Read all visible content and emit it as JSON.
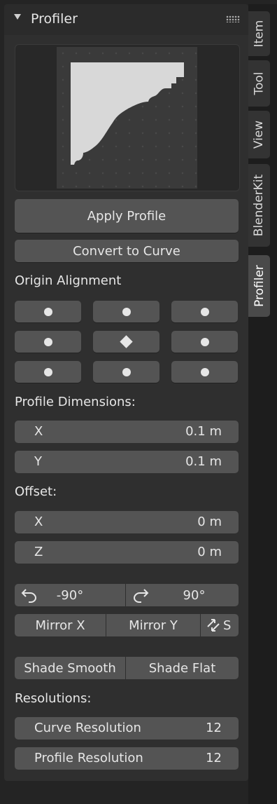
{
  "panel": {
    "title": "Profiler",
    "collapse_icon": "triangle-down-icon",
    "drag_icon": "grip-dots-icon"
  },
  "buttons": {
    "apply_profile": "Apply Profile",
    "convert_to_curve": "Convert to Curve"
  },
  "origin_alignment": {
    "label": "Origin Alignment",
    "grid": [
      [
        "dot",
        "dot",
        "dot"
      ],
      [
        "dot",
        "diamond",
        "dot"
      ],
      [
        "dot",
        "dot",
        "dot"
      ]
    ],
    "selected": "middle-center"
  },
  "profile_dimensions": {
    "label": "Profile Dimensions:",
    "x": {
      "key": "X",
      "value": "0.1 m"
    },
    "y": {
      "key": "Y",
      "value": "0.1 m"
    }
  },
  "offset": {
    "label": "Offset:",
    "x": {
      "key": "X",
      "value": "0 m"
    },
    "z": {
      "key": "Z",
      "value": "0 m"
    }
  },
  "rotate": {
    "ccw": {
      "icon": "rotate-ccw-icon",
      "label": "-90°"
    },
    "cw": {
      "icon": "rotate-cw-icon",
      "label": "90°"
    }
  },
  "mirror": {
    "x": "Mirror X",
    "y": "Mirror Y",
    "swap_icon": "swap-axes-icon",
    "swap_label": "S"
  },
  "shading": {
    "smooth": "Shade Smooth",
    "flat": "Shade Flat"
  },
  "resolutions": {
    "label": "Resolutions:",
    "curve": {
      "key": "Curve Resolution",
      "value": "12"
    },
    "profile": {
      "key": "Profile Resolution",
      "value": "12"
    }
  },
  "tabs": [
    {
      "label": "Item",
      "active": false
    },
    {
      "label": "Tool",
      "active": false
    },
    {
      "label": "View",
      "active": false
    },
    {
      "label": "BlenderKit",
      "active": false
    },
    {
      "label": "Profiler",
      "active": true
    }
  ],
  "colors": {
    "panel_bg": "#2f2f2f",
    "button_bg": "#545454",
    "text": "#e6e6e6",
    "profile_shape": "#d8d8d8"
  }
}
